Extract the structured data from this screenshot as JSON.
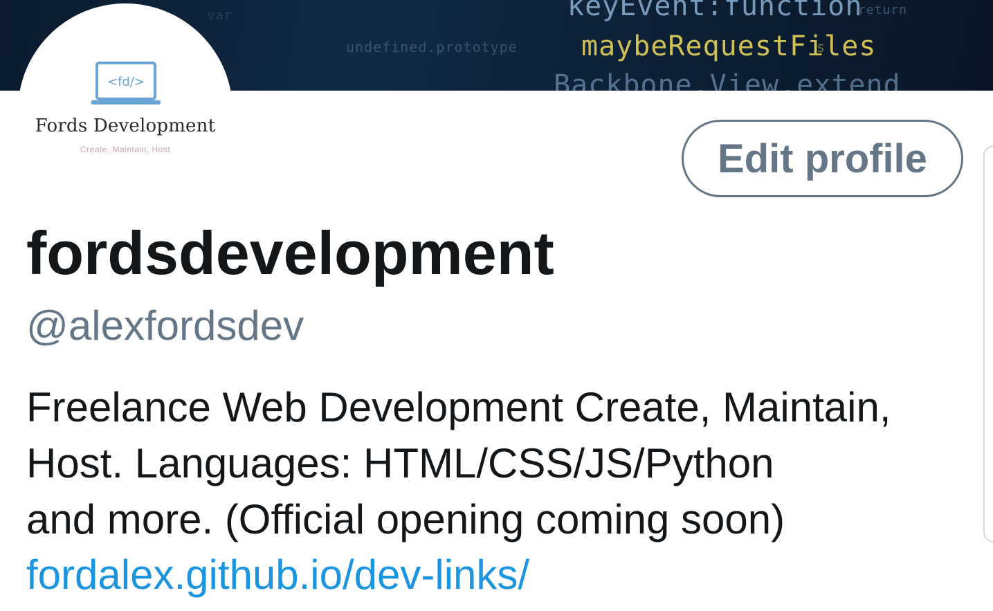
{
  "banner": {
    "code_lines": [
      "keyEvent:function",
      "maybeRequestFiles",
      "Backbone.View.extend",
      "undefined.prototype",
      "s",
      "var",
      "return"
    ]
  },
  "avatar": {
    "logo_glyph": "<fd/>",
    "logo_name": "Fords Development",
    "logo_tagline": "Create, Maintain, Host"
  },
  "profile": {
    "edit_button_label": "Edit profile",
    "display_name": "fordsdevelopment",
    "handle": "@alexfordsdev",
    "bio_lines": [
      "Freelance Web Development Create, Maintain,",
      "Host. Languages: HTML/CSS/JS/Python",
      "and more. (Official opening coming soon)"
    ],
    "link": "fordalex.github.io/dev-links/"
  },
  "colors": {
    "text_primary": "#14171a",
    "text_secondary": "#657786",
    "link": "#1b95e0",
    "banner_bg": "#0b1a2e"
  }
}
